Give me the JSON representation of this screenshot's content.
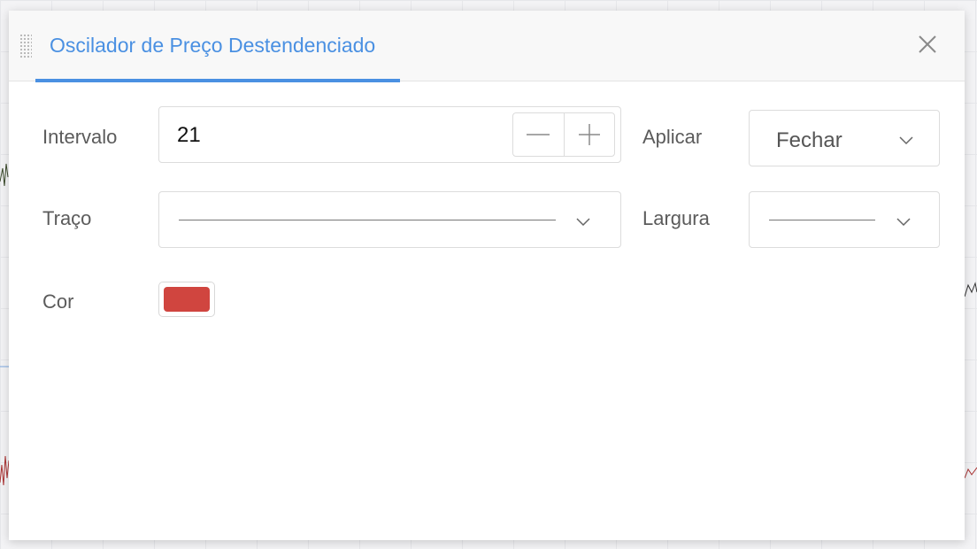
{
  "dialog": {
    "title": "Oscilador de Preço Destendenciado",
    "accent_color": "#4a90e2"
  },
  "fields": {
    "intervalo": {
      "label": "Intervalo",
      "value": "21"
    },
    "aplicar": {
      "label": "Aplicar",
      "selected": "Fechar"
    },
    "traco": {
      "label": "Traço",
      "selected_style": "solid"
    },
    "largura": {
      "label": "Largura",
      "selected_style": "thin"
    },
    "cor": {
      "label": "Cor",
      "color": "#d0453f"
    }
  },
  "icons": {
    "close": "close-icon",
    "minus": "minus-icon",
    "plus": "plus-icon",
    "chevron": "chevron-down-icon",
    "drag": "drag-handle-icon"
  }
}
